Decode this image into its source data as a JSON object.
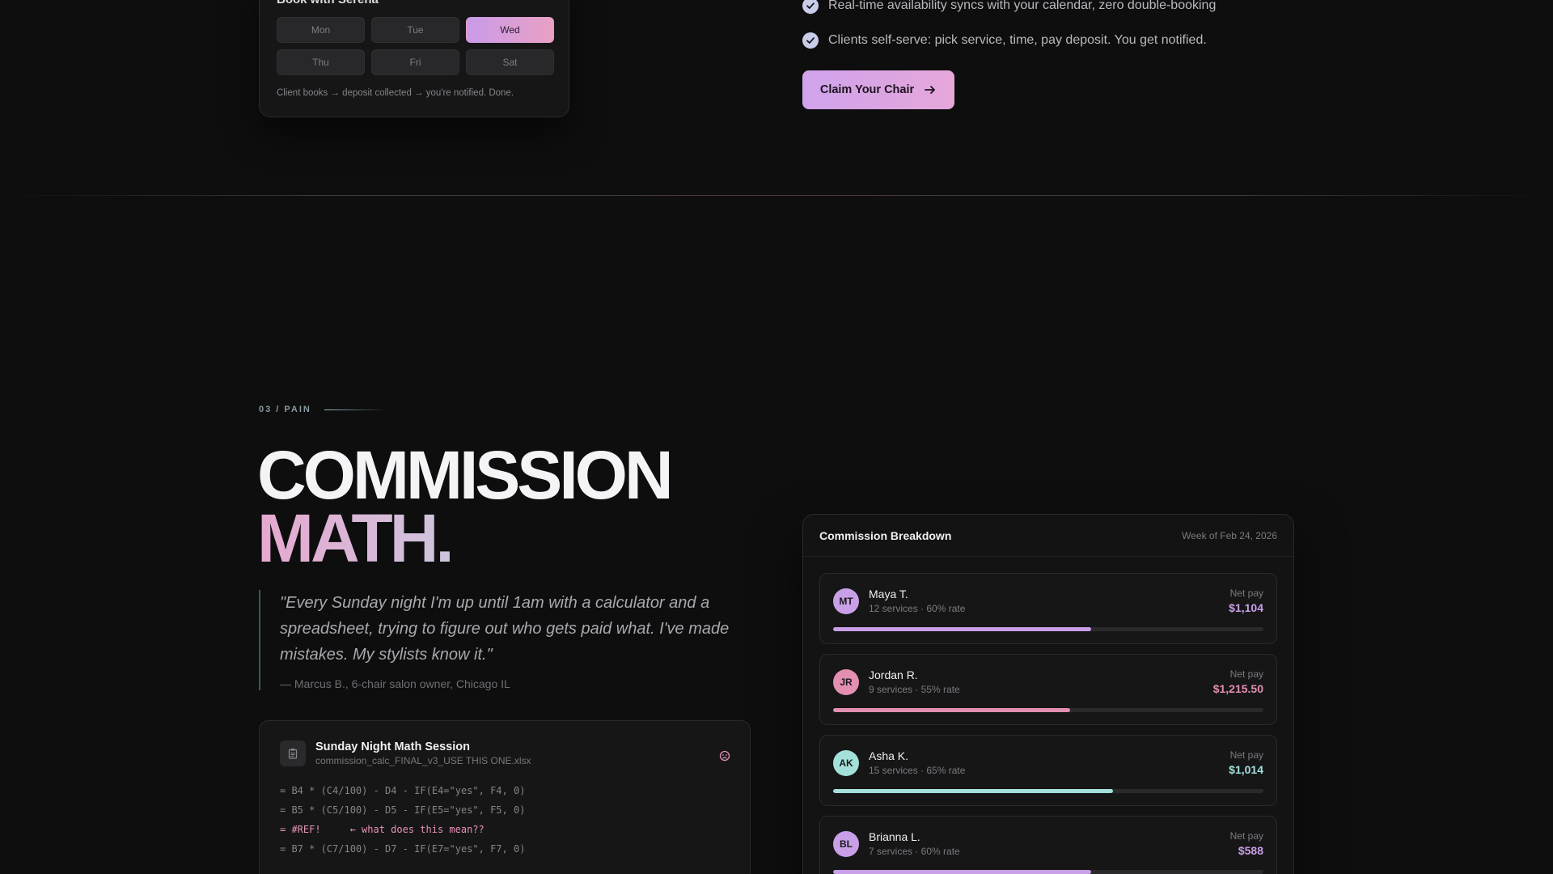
{
  "booking": {
    "title": "Book with Serena",
    "days": [
      {
        "label": "Mon",
        "active": false
      },
      {
        "label": "Tue",
        "active": false
      },
      {
        "label": "Wed",
        "active": true
      },
      {
        "label": "Thu",
        "active": false
      },
      {
        "label": "Fri",
        "active": false
      },
      {
        "label": "Sat",
        "active": false
      }
    ],
    "note": "Client books → deposit collected → you're notified. Done."
  },
  "features": [
    "Real-time availability syncs with your calendar, zero double-booking",
    "Clients self-serve: pick service, time, pay deposit. You get notified."
  ],
  "cta": {
    "label": "Claim Your Chair"
  },
  "section": {
    "label": "03 / PAIN"
  },
  "headline": {
    "line1": "COMMISSION",
    "line2": "MATH."
  },
  "quote": {
    "text": "\"Every Sunday night I'm up until 1am with a calculator and a spreadsheet, trying to figure out who gets paid what. I've made mistakes. My stylists know it.\"",
    "author": "— Marcus B., 6-chair salon owner, Chicago IL"
  },
  "sheet": {
    "title": "Sunday Night Math Session",
    "file": "commission_calc_FINAL_v3_USE THIS ONE.xlsx",
    "formulas": [
      {
        "text": "= B4 * (C4/100) - D4 - IF(E4=\"yes\", F4, 0)",
        "error": false,
        "note": ""
      },
      {
        "text": "= B5 * (C5/100) - D5 - IF(E5=\"yes\", F5, 0)",
        "error": false,
        "note": ""
      },
      {
        "text": "= #REF!",
        "error": true,
        "note": "← what does this mean??"
      },
      {
        "text": "= B7 * (C7/100) - D7 - IF(E7=\"yes\", F7, 0)",
        "error": false,
        "note": ""
      }
    ]
  },
  "panel": {
    "title": "Commission Breakdown",
    "week": "Week of Feb 24, 2026",
    "pay_label": "Net pay",
    "stylists": [
      {
        "initials": "MT",
        "name": "Maya T.",
        "meta": "12 services · 60% rate",
        "pay": "$1,104",
        "color": "#c9a0e8",
        "progress": 0.6
      },
      {
        "initials": "JR",
        "name": "Jordan R.",
        "meta": "9 services · 55% rate",
        "pay": "$1,215.50",
        "color": "#e38fb2",
        "progress": 0.55
      },
      {
        "initials": "AK",
        "name": "Asha K.",
        "meta": "15 services · 65% rate",
        "pay": "$1,014",
        "color": "#a3e0da",
        "progress": 0.65
      },
      {
        "initials": "BL",
        "name": "Brianna L.",
        "meta": "7 services · 60% rate",
        "pay": "$588",
        "color": "#c9a0e8",
        "progress": 0.6
      }
    ]
  }
}
